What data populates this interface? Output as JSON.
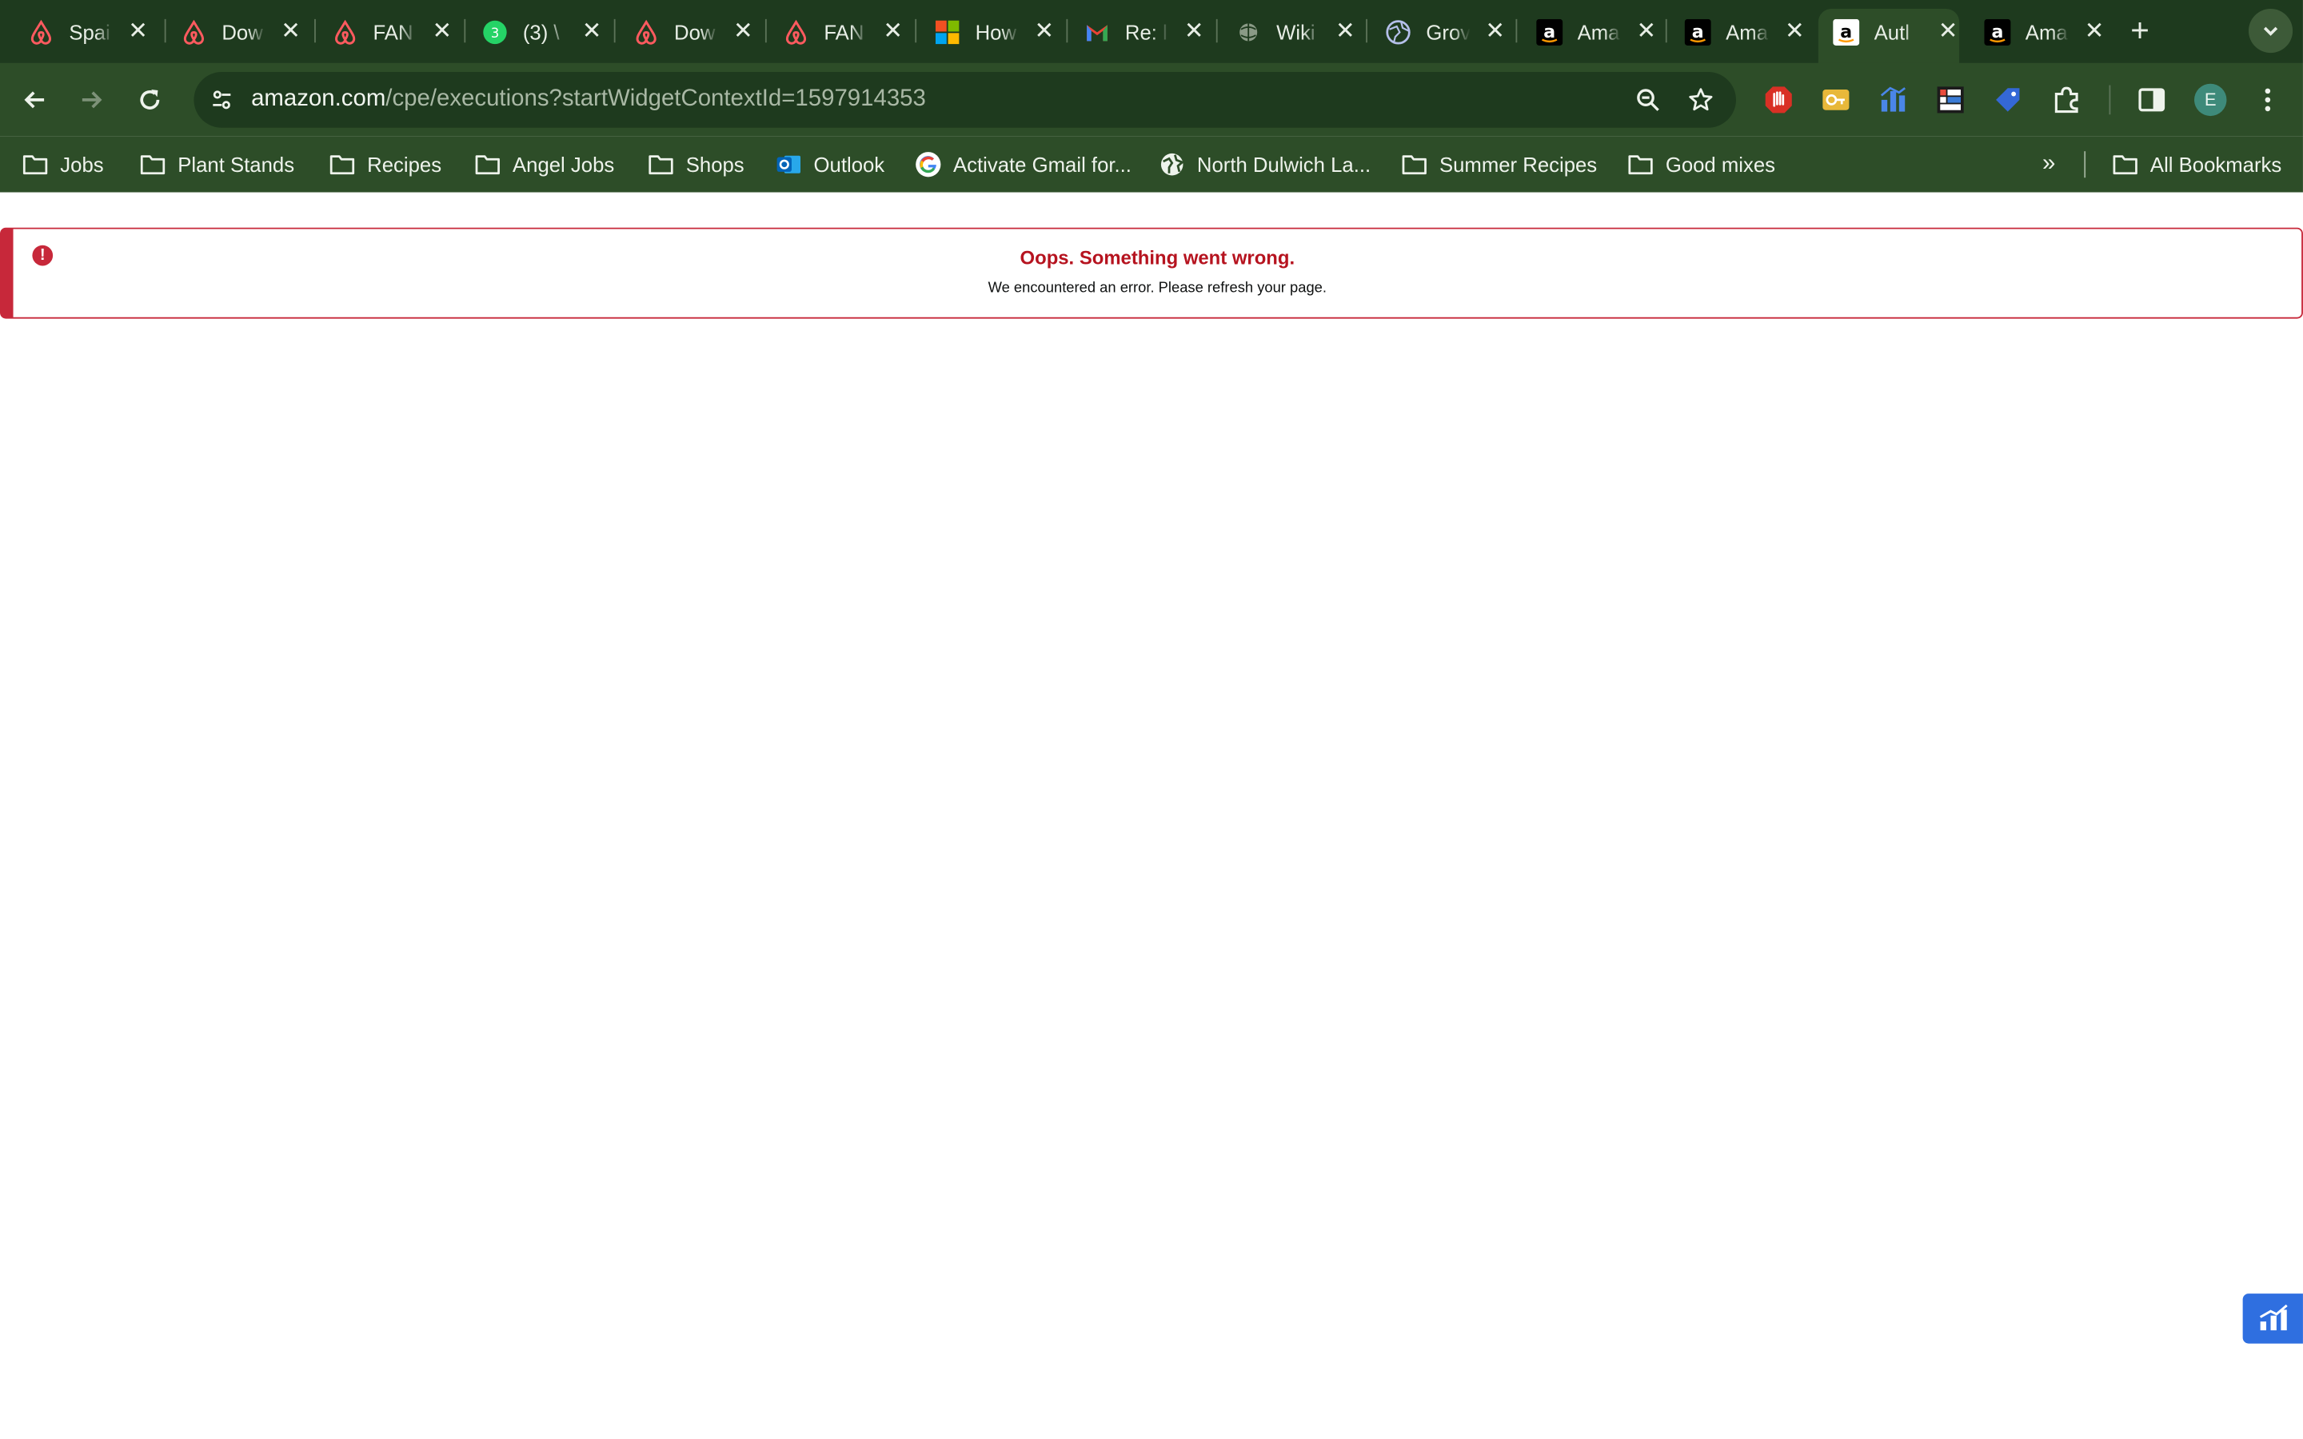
{
  "browser": {
    "tabs": [
      {
        "icon": "airbnb-icon",
        "title": "Spai"
      },
      {
        "icon": "airbnb-icon",
        "title": "Dow"
      },
      {
        "icon": "airbnb-icon",
        "title": "FAN"
      },
      {
        "icon": "whatsapp-icon",
        "title": "(3) \\"
      },
      {
        "icon": "airbnb-icon",
        "title": "Dow"
      },
      {
        "icon": "airbnb-icon",
        "title": "FAN"
      },
      {
        "icon": "microsoft-icon",
        "title": "How"
      },
      {
        "icon": "gmail-icon",
        "title": "Re: l"
      },
      {
        "icon": "wikipedia-icon",
        "title": "Wiki"
      },
      {
        "icon": "globe-icon",
        "title": "Grov"
      },
      {
        "icon": "amazon-icon",
        "title": "Ama"
      },
      {
        "icon": "amazon-icon",
        "title": "Ama"
      },
      {
        "icon": "amazon-icon",
        "title": "Autl",
        "active": true
      },
      {
        "icon": "amazon-icon",
        "title": "Ama"
      }
    ],
    "whatsapp_badge": "3",
    "url_host": "amazon.com",
    "url_path": "/cpe/executions?startWidgetContextId=1597914353",
    "profile_initial": "E",
    "bookmarks": [
      {
        "icon": "folder-icon",
        "label": "Jobs"
      },
      {
        "icon": "folder-icon",
        "label": "Plant Stands"
      },
      {
        "icon": "folder-icon",
        "label": "Recipes"
      },
      {
        "icon": "folder-icon",
        "label": "Angel Jobs"
      },
      {
        "icon": "folder-icon",
        "label": "Shops"
      },
      {
        "icon": "outlook-icon",
        "label": "Outlook"
      },
      {
        "icon": "google-icon",
        "label": "Activate Gmail for..."
      },
      {
        "icon": "globe-icon",
        "label": "North Dulwich La..."
      },
      {
        "icon": "folder-icon",
        "label": "Summer Recipes"
      },
      {
        "icon": "folder-icon",
        "label": "Good mixes"
      }
    ],
    "all_bookmarks_label": "All Bookmarks",
    "colors": {
      "frame": "#1e3a1e",
      "toolbar": "#2d4d28"
    }
  },
  "page": {
    "alert": {
      "title": "Oops. Something went wrong.",
      "message": "We encountered an error. Please refresh your page.",
      "color": "#c7283a"
    }
  }
}
